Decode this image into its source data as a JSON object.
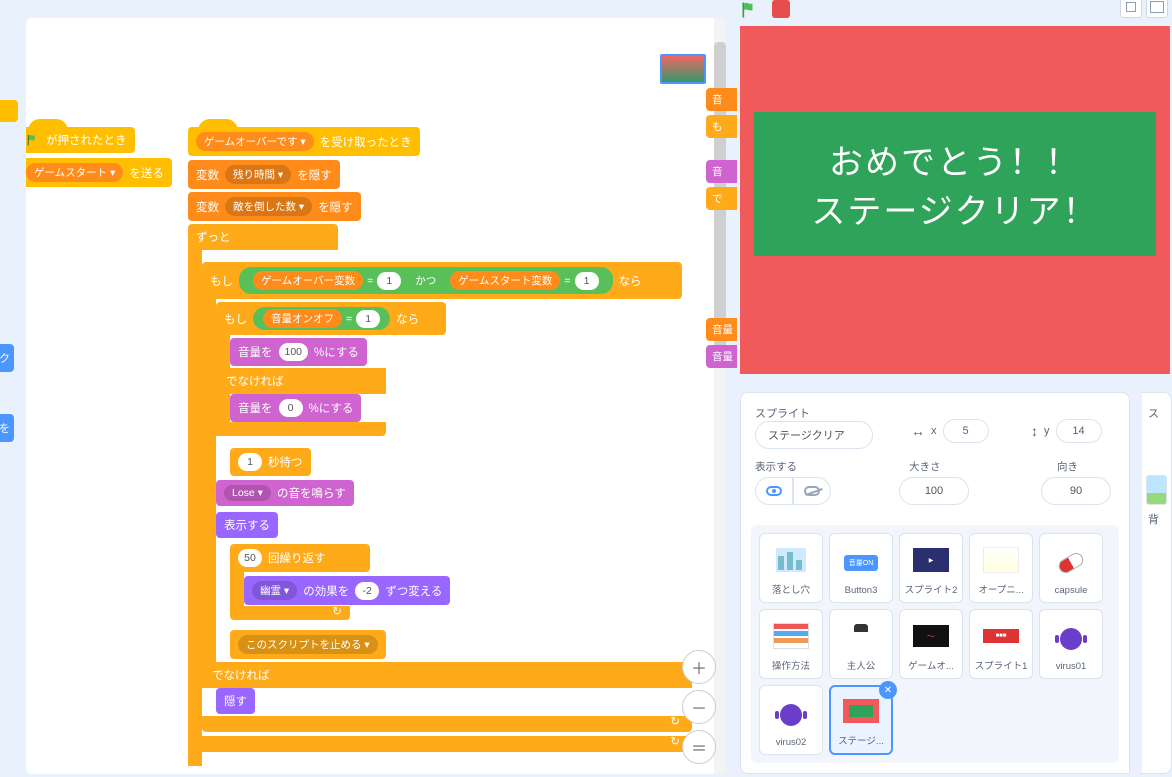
{
  "stage": {
    "line1": "おめでとう！！",
    "line2": "ステージクリア！"
  },
  "left_peeks": {
    "p1": "が押されたとき",
    "p2_opt": "ゲームスタート ▾",
    "p2_suffix": "を送る",
    "p3": "ク",
    "p4": "を"
  },
  "right_peeks": [
    "音",
    "も",
    "音",
    "で",
    "音量",
    "音量"
  ],
  "blocks": {
    "b1_opt": "ゲームオーバーです ▾",
    "b1_suffix": "を受け取ったとき",
    "b2_pre": "変数",
    "b2_var": "残り時間 ▾",
    "b2_suf": "を隠す",
    "b3_pre": "変数",
    "b3_var": "敵を倒した数 ▾",
    "b3_suf": "を隠す",
    "b4": "ずっと",
    "b5_pre": "もし",
    "b5_v1": "ゲームオーバー変数",
    "b5_eq": "=",
    "b5_n1": "1",
    "b5_and": "かつ",
    "b5_v2": "ゲームスタート変数",
    "b5_n2": "1",
    "b5_then": "なら",
    "b6_pre": "もし",
    "b6_v": "音量オンオフ",
    "b6_eq": "=",
    "b6_n": "1",
    "b6_then": "なら",
    "b7_pre": "音量を",
    "b7_n": "100",
    "b7_suf": "%にする",
    "b8": "でなければ",
    "b9_pre": "音量を",
    "b9_n": "0",
    "b9_suf": "%にする",
    "b10_n": "1",
    "b10_suf": "秒待つ",
    "b11_opt": "Lose ▾",
    "b11_suf": "の音を鳴らす",
    "b12": "表示する",
    "b13_n": "50",
    "b13_suf": "回繰り返す",
    "b14_opt": "幽霊 ▾",
    "b14_mid": "の効果を",
    "b14_n": "-2",
    "b14_suf": "ずつ変える",
    "b15": "このスクリプトを止める ▾",
    "b16": "でなければ",
    "b17": "隠す"
  },
  "info": {
    "title": "スプライト",
    "name": "ステージクリア",
    "x_lbl": "x",
    "x": "5",
    "y_lbl": "y",
    "y": "14",
    "show_lbl": "表示する",
    "size_lbl": "大きさ",
    "size": "100",
    "dir_lbl": "向き",
    "dir": "90"
  },
  "stage_pane": {
    "title": "ス",
    "backdrops_lbl": "背"
  },
  "sprites": [
    {
      "name": "落とし穴"
    },
    {
      "name": "Button3"
    },
    {
      "name": "スプライト2"
    },
    {
      "name": "オープニ..."
    },
    {
      "name": "capsule"
    },
    {
      "name": "操作方法"
    },
    {
      "name": "主人公"
    },
    {
      "name": "ゲームオ..."
    },
    {
      "name": "スプライト1"
    },
    {
      "name": "virus01"
    },
    {
      "name": "virus02"
    },
    {
      "name": "ステージ..."
    }
  ],
  "icons": {
    "x_arrows": "↔",
    "y_arrows": "↕"
  }
}
